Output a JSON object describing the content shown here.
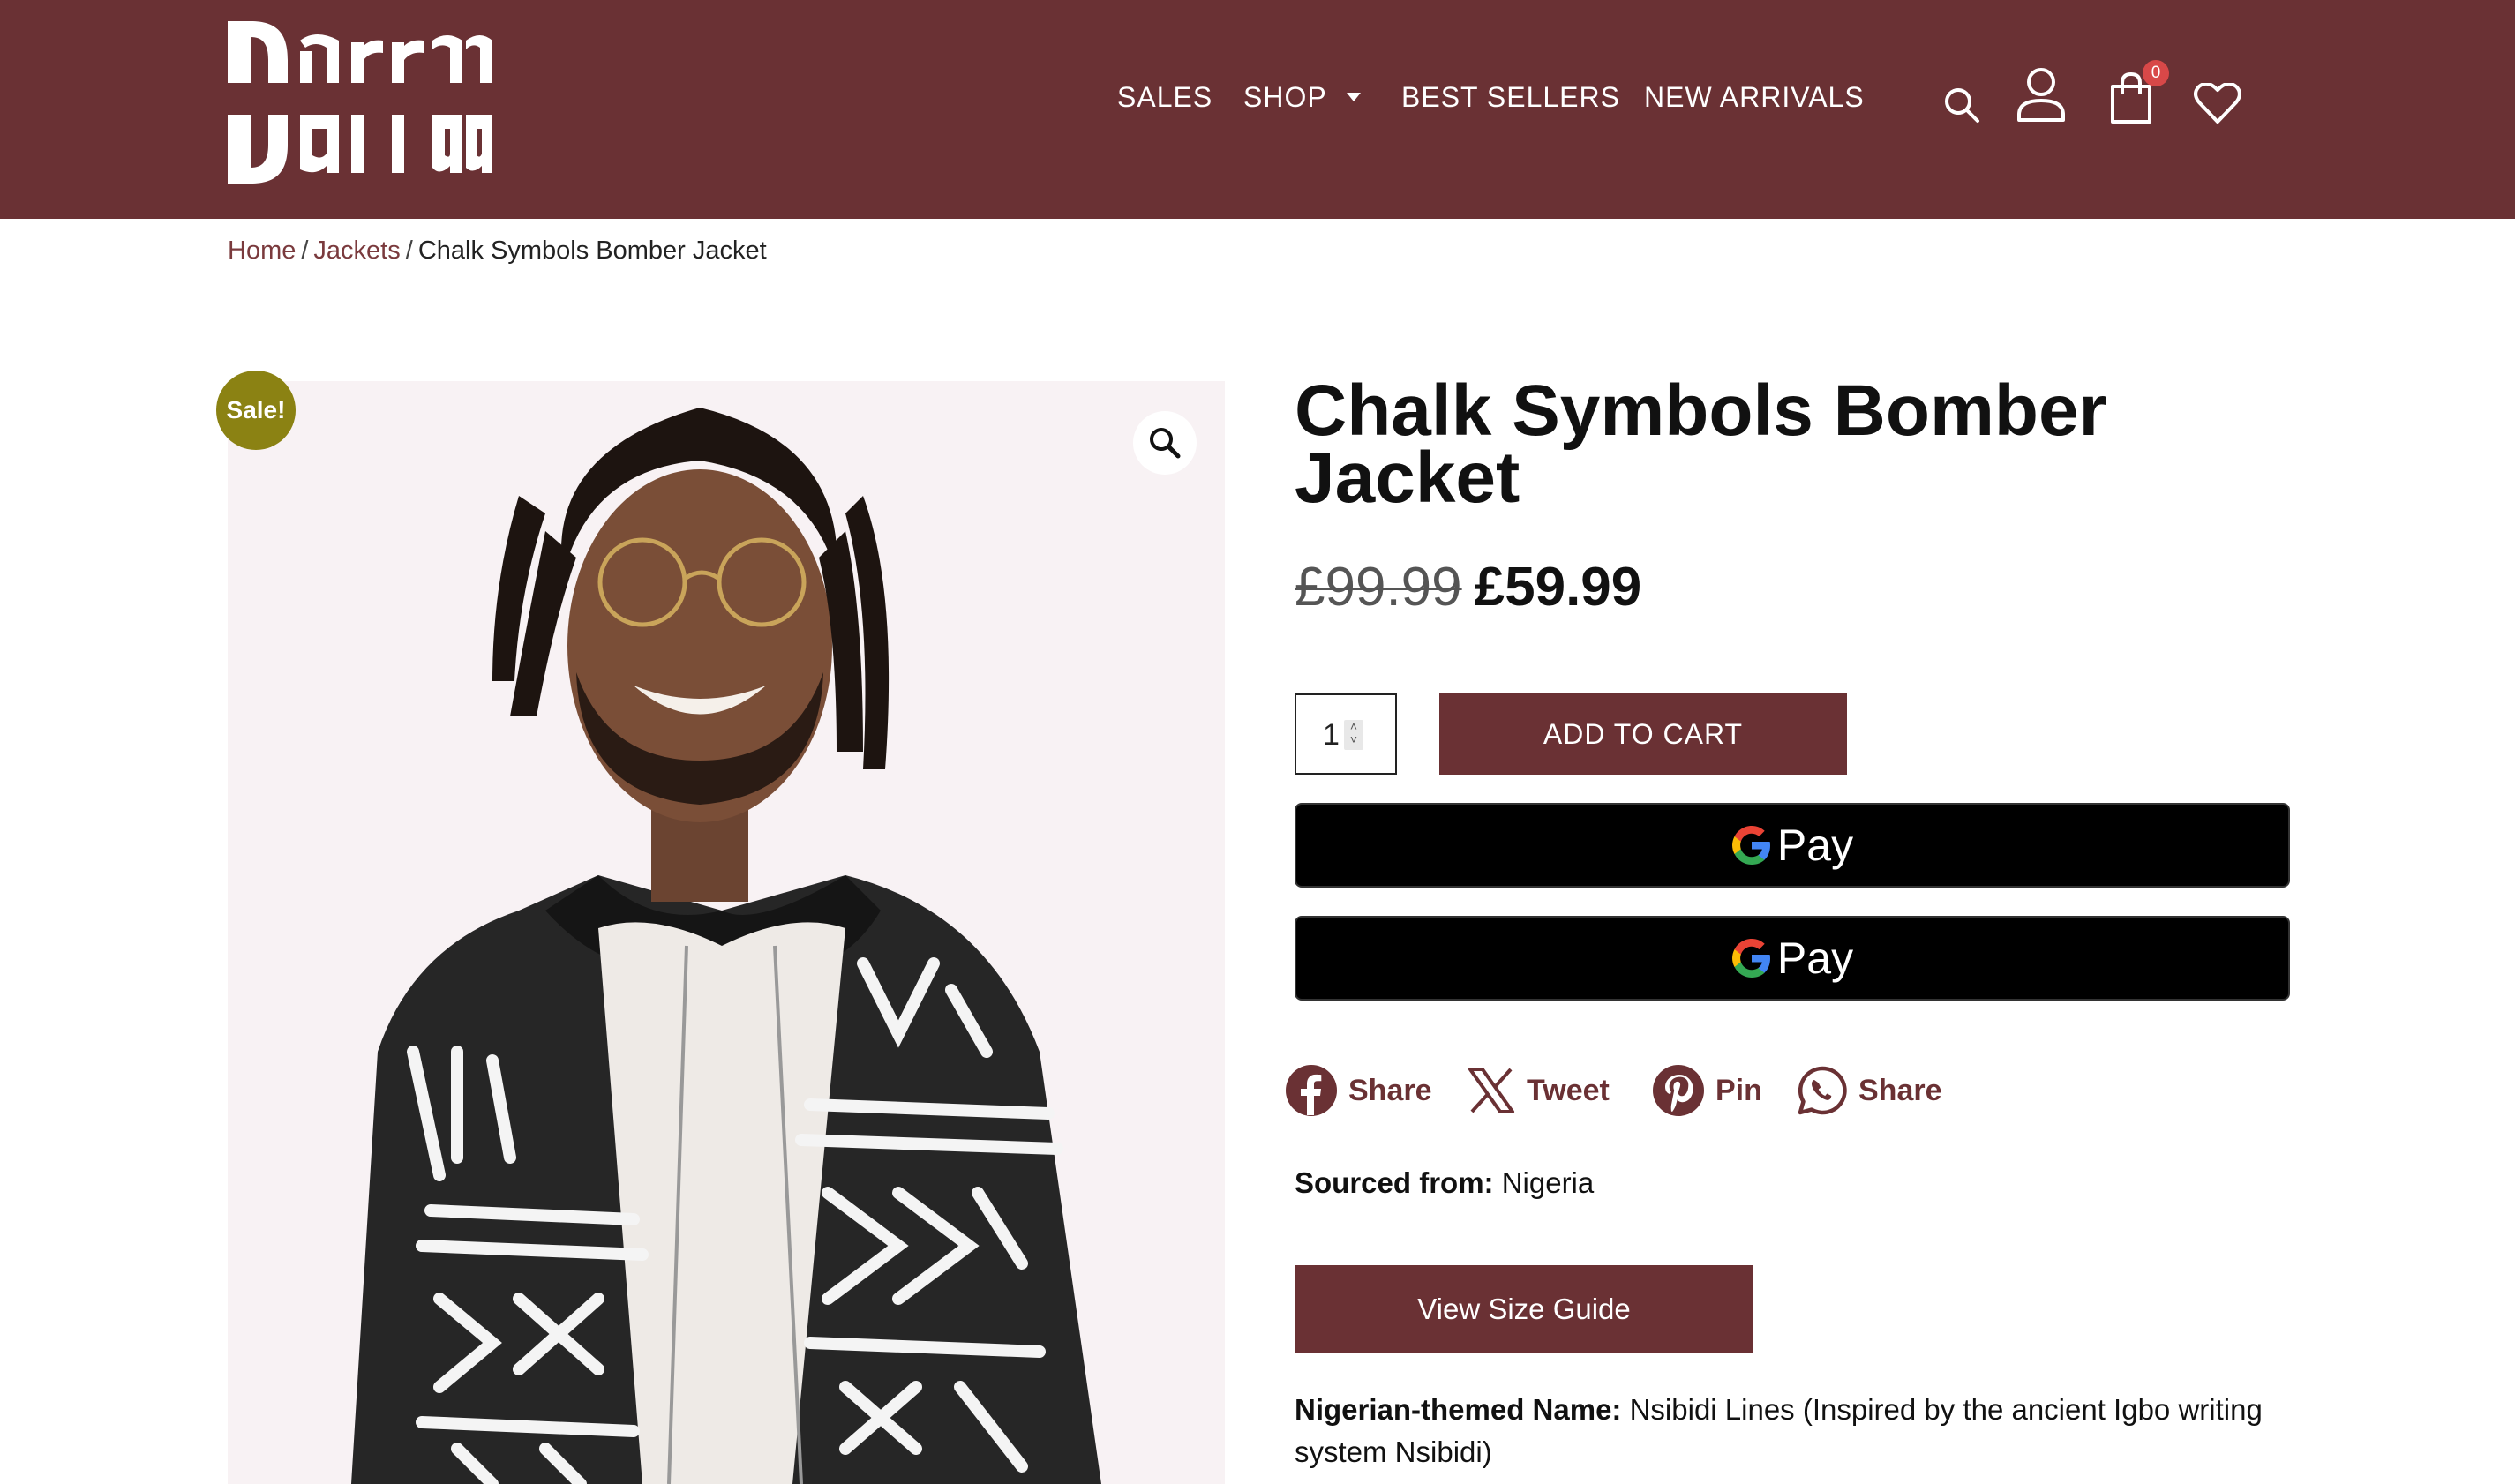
{
  "header": {
    "logo_text": "Darraa",
    "nav": [
      {
        "label": "SALES"
      },
      {
        "label": "SHOP"
      },
      {
        "label": "BEST SELLERS"
      },
      {
        "label": "NEW ARRIVALS"
      }
    ],
    "icons": [
      "search-icon",
      "account-icon",
      "cart-icon",
      "wishlist-icon"
    ],
    "cart_count": "0"
  },
  "breadcrumb": {
    "home": "Home",
    "sep1": "/",
    "category": "Jackets",
    "sep2": "/",
    "current": "Chalk Symbols Bomber Jacket"
  },
  "product": {
    "sale_badge": "Sale!",
    "title": "Chalk Symbols Bomber Jacket",
    "old_price": "£99.99",
    "new_price": "£59.99",
    "quantity": "1",
    "add_to_cart": "ADD TO CART",
    "gpay_label": "Pay",
    "share": {
      "facebook": "Share",
      "twitter": "Tweet",
      "pinterest": "Pin",
      "whatsapp": "Share"
    },
    "sourced_label": "Sourced from:",
    "sourced_value": "Nigeria",
    "size_guide": "View Size Guide",
    "theme_label": "Nigerian-themed Name:",
    "theme_value": "Nsibidi Lines (Inspired by the ancient Igbo writing system Nsibidi)"
  },
  "colors": {
    "brand": "#6a3134",
    "sale_badge": "#8b8213",
    "cart_badge": "#d84848"
  }
}
